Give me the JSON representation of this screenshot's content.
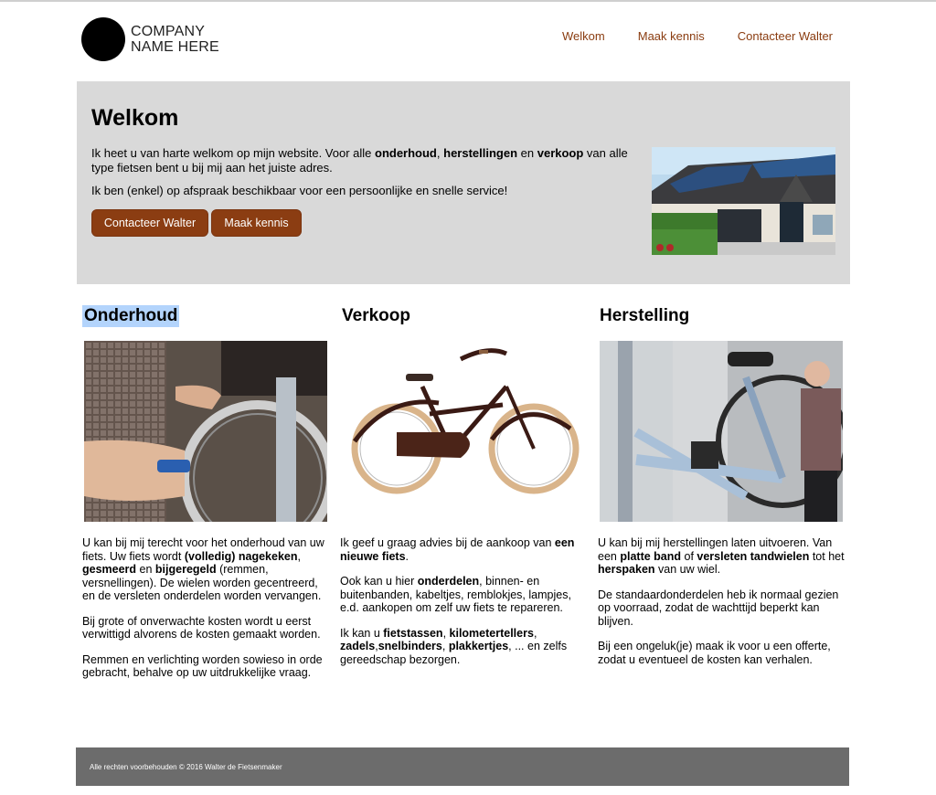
{
  "company": {
    "line1": "COMPANY",
    "line2": "NAME HERE"
  },
  "nav": {
    "items": [
      "Welkom",
      "Maak kennis",
      "Contacteer Walter"
    ]
  },
  "hero": {
    "title": "Welkom",
    "p1_pre": "Ik heet u van harte welkom op mijn website. Voor alle ",
    "p1_b1": "onderhoud",
    "p1_sep1": ", ",
    "p1_b2": "herstellingen",
    "p1_mid": " en ",
    "p1_b3": "verkoop",
    "p1_post": " van alle type fietsen bent u bij mij aan het juiste adres.",
    "p2": "Ik ben (enkel) op afspraak beschikbaar voor een persoonlijke en snelle service!",
    "btn_contact": "Contacteer Walter",
    "btn_meet": "Maak kennis"
  },
  "columns": {
    "onderhoud": {
      "title": "Onderhoud",
      "p1_a": "U kan bij mij terecht voor het onderhoud van uw fiets. Uw fiets wordt ",
      "p1_b": "(volledig) nagekeken",
      "p1_c": ", ",
      "p1_d": "gesmeerd",
      "p1_e": " en ",
      "p1_f": "bijgeregeld",
      "p1_g": " (remmen, versnellingen). De wielen worden gecentreerd, en de versleten onderdelen worden vervangen.",
      "p2": "Bij grote of onverwachte kosten wordt u eerst verwittigd alvorens de kosten gemaakt worden.",
      "p3": "Remmen en verlichting worden sowieso in orde gebracht, behalve op uw uitdrukkelijke vraag."
    },
    "verkoop": {
      "title": "Verkoop",
      "p1_a": "Ik geef u graag advies bij de aankoop van ",
      "p1_b": "een nieuwe fiets",
      "p1_c": ".",
      "p2_a": "Ook kan u hier ",
      "p2_b": "onderdelen",
      "p2_c": ", binnen- en buitenbanden, kabeltjes, remblokjes, lampjes, e.d. aankopen om zelf uw fiets te repareren.",
      "p3_a": "Ik kan u ",
      "p3_b": "fietstassen",
      "p3_c": ", ",
      "p3_d": "kilometertellers",
      "p3_e": ", ",
      "p3_f": "zadels",
      "p3_g": ",",
      "p3_h": "snelbinders",
      "p3_i": ", ",
      "p3_j": "plakkertjes",
      "p3_k": ", ... en zelfs gereedschap bezorgen."
    },
    "herstelling": {
      "title": "Herstelling",
      "p1_a": "U kan bij mij herstellingen laten uitvoeren. Van een ",
      "p1_b": "platte band",
      "p1_c": " of ",
      "p1_d": "versleten tandwielen",
      "p1_e": " tot het ",
      "p1_f": "herspaken",
      "p1_g": " van uw wiel.",
      "p2": "De standaardonderdelen heb ik normaal gezien op voorraad, zodat de wachttijd beperkt kan blijven.",
      "p3": "Bij een ongeluk(je) maak ik voor u een offerte, zodat u eventueel de kosten kan verhalen."
    }
  },
  "footer": {
    "text": "Alle rechten voorbehouden © 2016 Walter de Fietsenmaker"
  },
  "colors": {
    "accent": "#8b3d12",
    "nav": "#8a3c10",
    "hero_bg": "#d9d9d9",
    "footer_bg": "#6c6c6c",
    "highlight": "#b3d4fc"
  }
}
